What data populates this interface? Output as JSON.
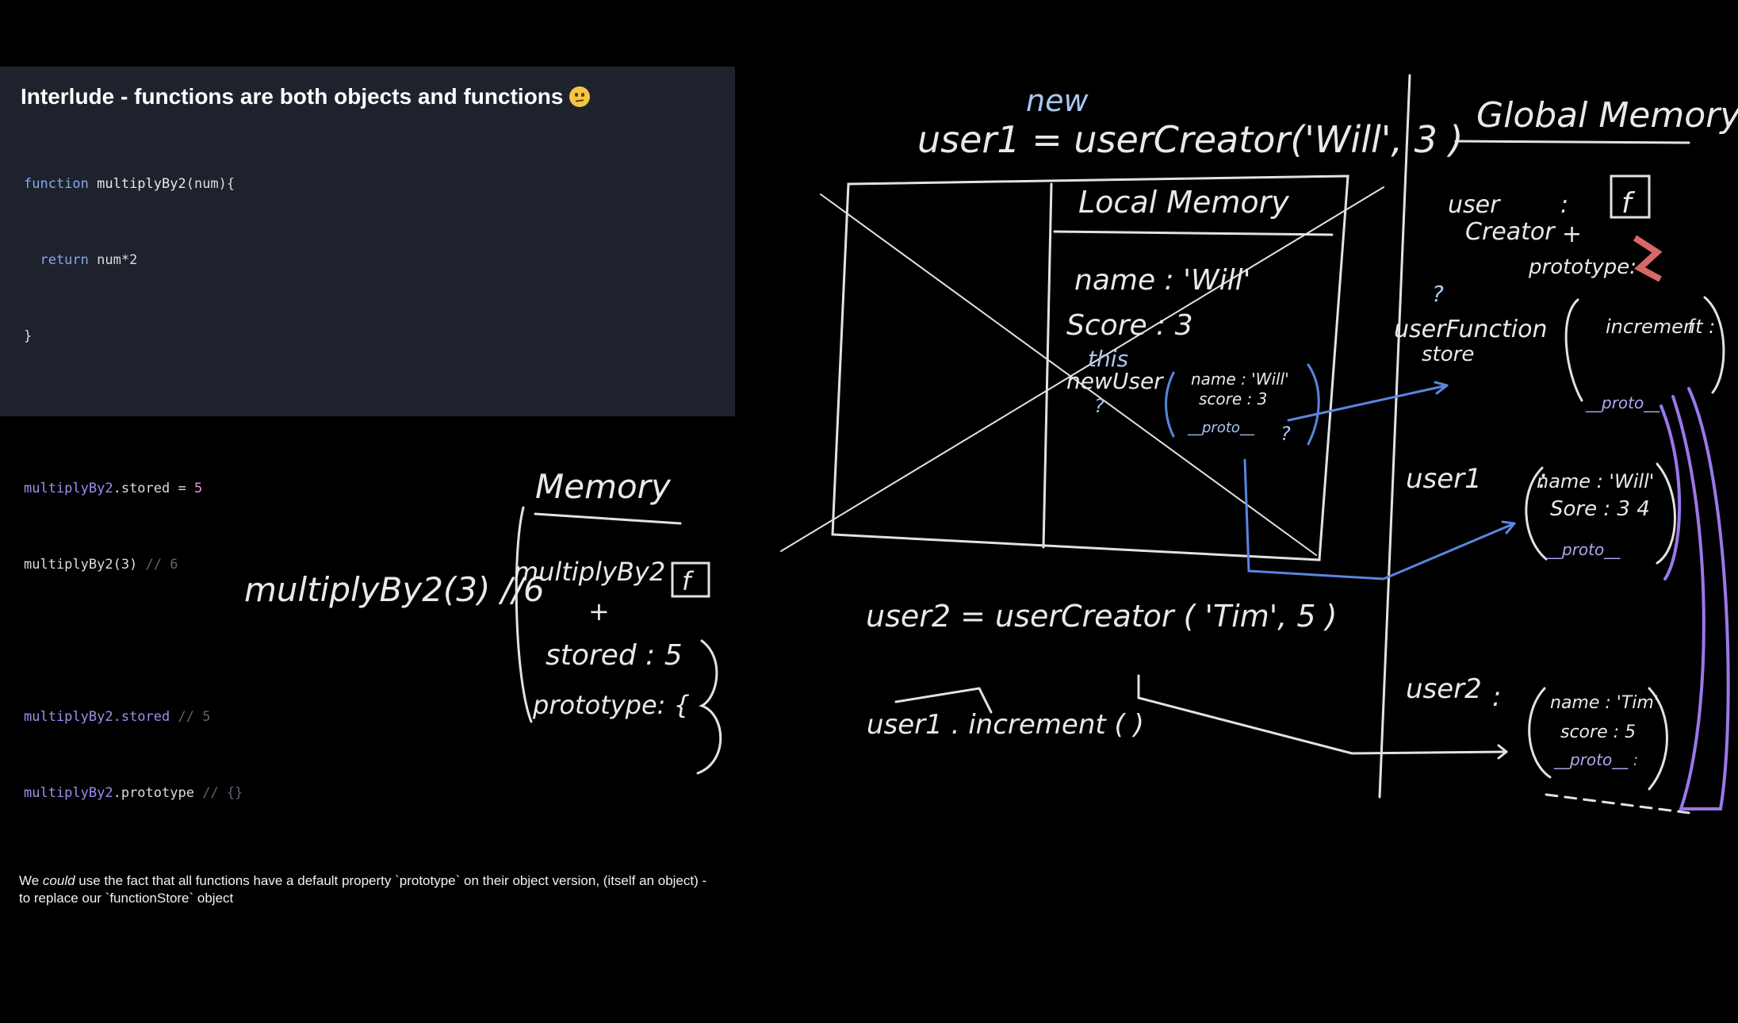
{
  "slide": {
    "title": "Interlude - functions are both objects and functions",
    "emoji_icon": "confused-face-icon",
    "code_lines": [
      [
        "function",
        " multiplyBy2",
        "(num){"
      ],
      [
        "  return",
        " num*2"
      ],
      [
        "}"
      ],
      [
        ""
      ],
      [
        "multiplyBy2",
        ".stored = ",
        "5"
      ],
      [
        "multiplyBy2(3)",
        " // 6"
      ],
      [
        ""
      ],
      [
        "multiplyBy2",
        ".stored",
        " // 5"
      ],
      [
        "multiplyBy2",
        ".prototype",
        " // {}"
      ]
    ],
    "description_parts": [
      "We ",
      "could",
      " use the fact that all functions have a default property `prototype` on their object version, (itself an object) - to replace our `functionStore` object"
    ]
  },
  "left_board": {
    "memory_heading": "Memory",
    "call_line": "multiplyBy2(3) //6",
    "fn_label": "multiplyBy2",
    "fn_box": "f",
    "plus": "+",
    "stored_line": "stored : 5",
    "prototype_line": "prototype: {",
    "brace_open_left": "{",
    "brace_close_right": "}",
    "brace_close_outer": "}}"
  },
  "center_board": {
    "new_keyword": "new",
    "user1_line": "user1 = userCreator('Will', 3 )",
    "local_memory_heading": "Local Memory",
    "name_line": "name : 'Will'",
    "score_line": "Score : 3",
    "this_label": "this",
    "newuser_label": "newUser",
    "question_mark": "?",
    "obj_name": "name : 'Will'",
    "obj_score": "score : 3",
    "obj_proto": "__proto__",
    "obj_proto_q": "?",
    "user2_line": "user2 = userCreator ( 'Tim', 5 )",
    "increment_line": "user1 . increment ( )"
  },
  "global_board": {
    "heading": "Global Memory",
    "usercreator_label_1": "user",
    "usercreator_label_2": "Creator",
    "colon": ":",
    "fn_box": "f",
    "plus": "+",
    "prototype_label": "prototype:",
    "question_mark": "?",
    "userfunctionstore_1": "userFunction",
    "userfunctionstore_2": "store",
    "increment_entry": "increment :",
    "increment_box": "f",
    "proto_short": "__proto__",
    "user1_label": "user1",
    "user1_name": "name : 'Will'",
    "user1_score": "Sore : 3 4",
    "user1_proto": "__proto__",
    "user2_label": "user2",
    "user2_name": "name : 'Tim'",
    "user2_score": "score : 5",
    "user2_proto": "__proto__ :"
  }
}
